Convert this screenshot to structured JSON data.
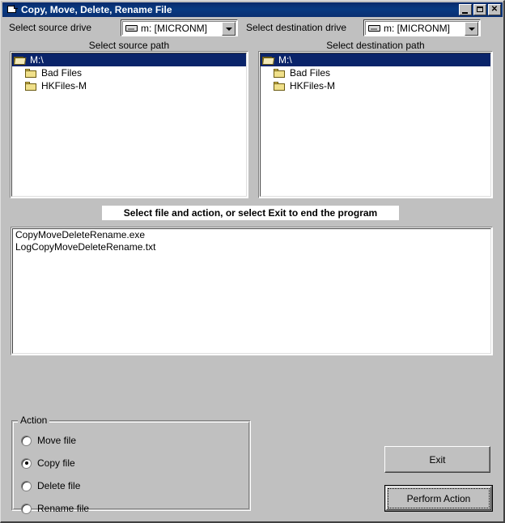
{
  "window": {
    "title": "Copy, Move, Delete, Rename File",
    "icon": "app-window-icon",
    "minimize_label": "_",
    "maximize_label": "",
    "close_label": "✕"
  },
  "source": {
    "drive_label": "Select source drive",
    "drive_value": "m: [MICRONM]",
    "path_label": "Select source path",
    "tree": [
      {
        "label": "M:\\",
        "icon": "open-folder-icon",
        "selected": true,
        "indent": 0
      },
      {
        "label": "Bad Files",
        "icon": "folder-icon",
        "selected": false,
        "indent": 1
      },
      {
        "label": "HKFiles-M",
        "icon": "folder-icon",
        "selected": false,
        "indent": 1
      }
    ]
  },
  "destination": {
    "drive_label": "Select destination drive",
    "drive_value": "m: [MICRONM]",
    "path_label": "Select destination path",
    "tree": [
      {
        "label": "M:\\",
        "icon": "open-folder-icon",
        "selected": true,
        "indent": 0
      },
      {
        "label": "Bad Files",
        "icon": "folder-icon",
        "selected": false,
        "indent": 1
      },
      {
        "label": "HKFiles-M",
        "icon": "folder-icon",
        "selected": false,
        "indent": 1
      }
    ]
  },
  "banner": {
    "text": "Select file and action, or select Exit to end the program"
  },
  "file_list": {
    "files": [
      {
        "name": "CopyMoveDeleteRename.exe",
        "selected": false
      },
      {
        "name": "LogCopyMoveDeleteRename.txt",
        "selected": false
      }
    ]
  },
  "action_group": {
    "title": "Action",
    "options": [
      {
        "label": "Move file",
        "checked": false
      },
      {
        "label": "Copy file",
        "checked": true
      },
      {
        "label": "Delete file",
        "checked": false
      },
      {
        "label": "Rename file",
        "checked": false
      }
    ]
  },
  "buttons": {
    "exit": "Exit",
    "perform": "Perform Action"
  },
  "colors": {
    "face": "#c0c0c0",
    "titlebar": "#0a2f72",
    "selection": "#0a246a",
    "text": "#000000",
    "field": "#ffffff"
  }
}
